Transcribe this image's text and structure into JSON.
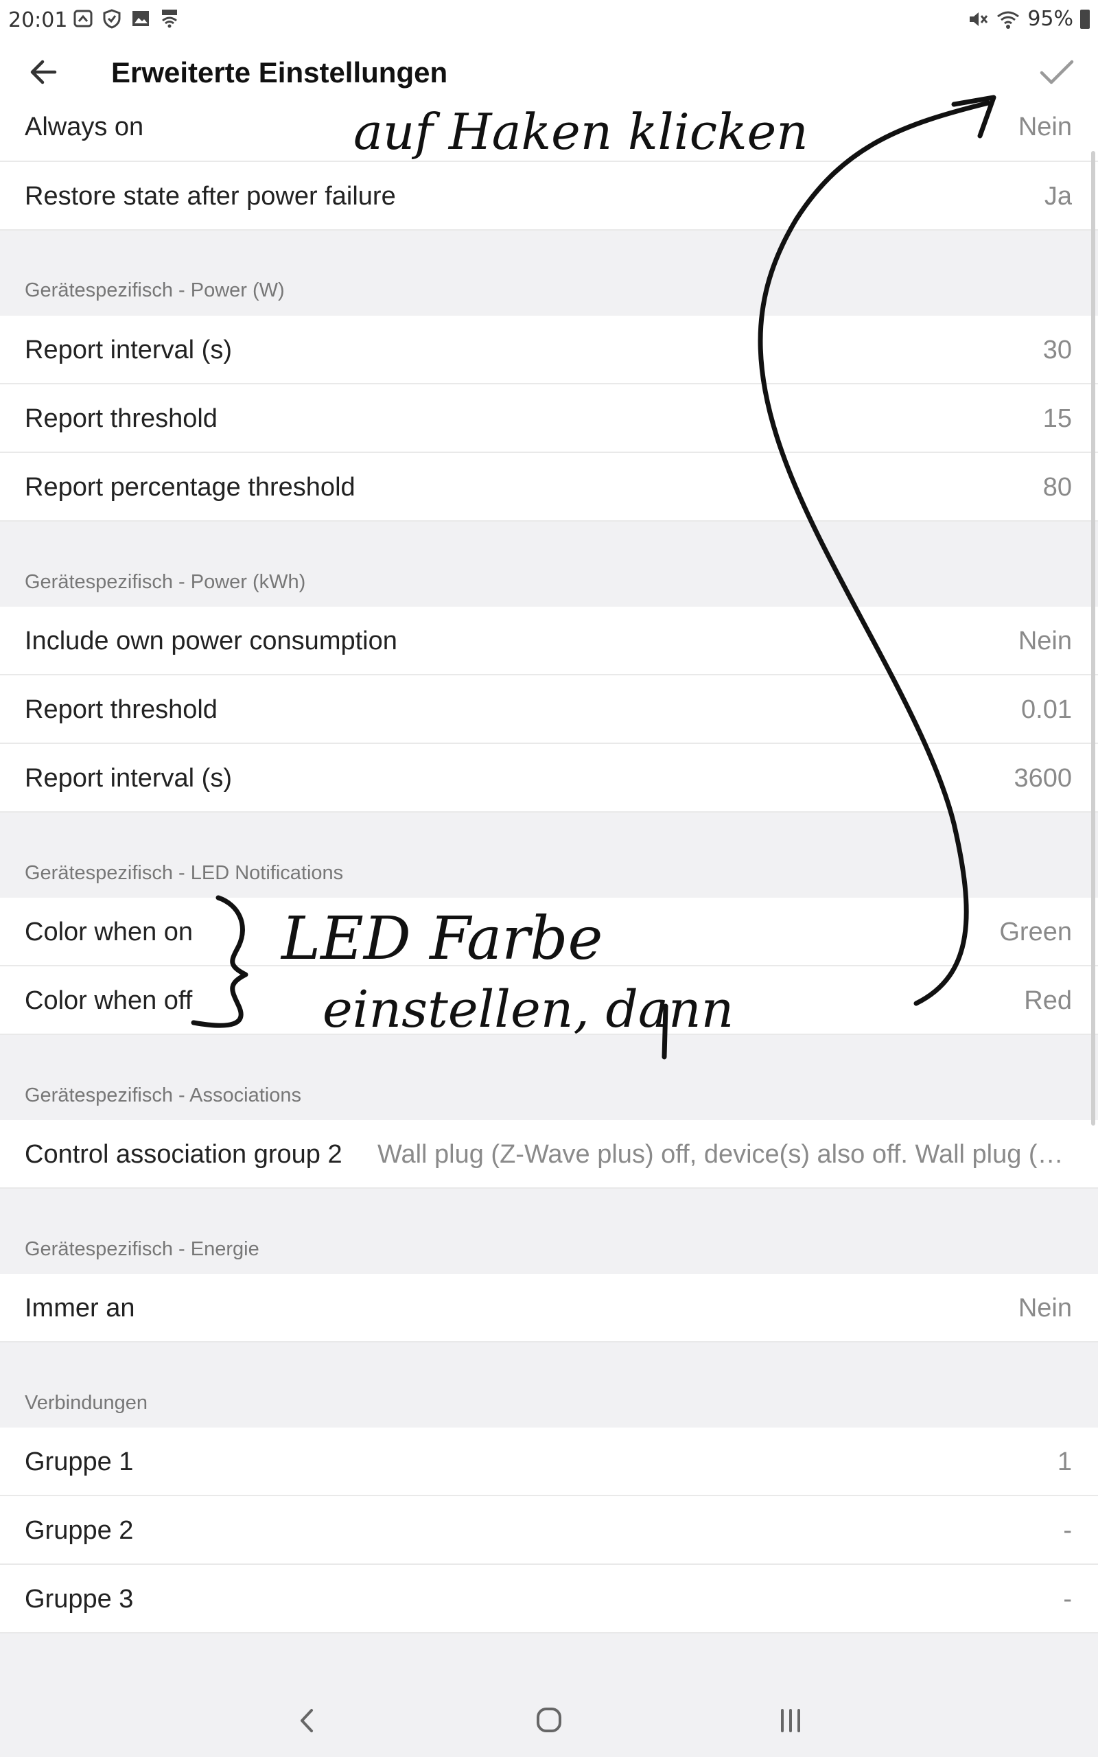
{
  "status_bar": {
    "time": "20:01",
    "left_icons": [
      "cloud-home-icon",
      "shield-icon",
      "image-icon",
      "wifi-app-icon"
    ],
    "right_icons": [
      "mute-icon",
      "wifi-icon"
    ],
    "battery": "95%"
  },
  "header": {
    "title": "Erweiterte Einstellungen",
    "back_icon": "back-arrow-icon",
    "confirm_icon": "checkmark-icon"
  },
  "top_rows": [
    {
      "label": "Always on",
      "value": "Nein"
    },
    {
      "label": "Restore state after power failure",
      "value": "Ja"
    }
  ],
  "sections": [
    {
      "header": "Gerätespezifisch - Power (W)",
      "rows": [
        {
          "label": "Report interval (s)",
          "value": "30"
        },
        {
          "label": "Report threshold",
          "value": "15"
        },
        {
          "label": "Report percentage threshold",
          "value": "80"
        }
      ]
    },
    {
      "header": "Gerätespezifisch - Power (kWh)",
      "rows": [
        {
          "label": "Include own power consumption",
          "value": "Nein"
        },
        {
          "label": "Report threshold",
          "value": "0.01"
        },
        {
          "label": "Report interval (s)",
          "value": "3600"
        }
      ]
    },
    {
      "header": "Gerätespezifisch - LED Notifications",
      "rows": [
        {
          "label": "Color when on",
          "value": "Green"
        },
        {
          "label": "Color when off",
          "value": "Red"
        }
      ]
    },
    {
      "header": "Gerätespezifisch - Associations",
      "rows": [
        {
          "label": "Control association group 2",
          "value": "Wall plug (Z-Wave plus) off, device(s) also off. Wall plug (Z-Wave plus) on, device(s) also on."
        }
      ]
    },
    {
      "header": "Gerätespezifisch - Energie",
      "rows": [
        {
          "label": "Immer an",
          "value": "Nein"
        }
      ]
    },
    {
      "header": "Verbindungen",
      "rows": [
        {
          "label": "Gruppe 1",
          "value": "1"
        },
        {
          "label": "Gruppe 2",
          "value": "-"
        },
        {
          "label": "Gruppe 3",
          "value": "-"
        }
      ]
    }
  ],
  "handwritten_notes": {
    "top": "auf Haken klicken",
    "middle_line1": "LED Farbe",
    "middle_line2": "einstellen, dann"
  },
  "nav_bar": {
    "icons": [
      "nav-back-icon",
      "nav-home-icon",
      "nav-recents-icon"
    ]
  },
  "colors": {
    "background": "#f1f1f3",
    "row": "#ffffff",
    "value_text": "#8a8a8a",
    "section_text": "#777777"
  }
}
